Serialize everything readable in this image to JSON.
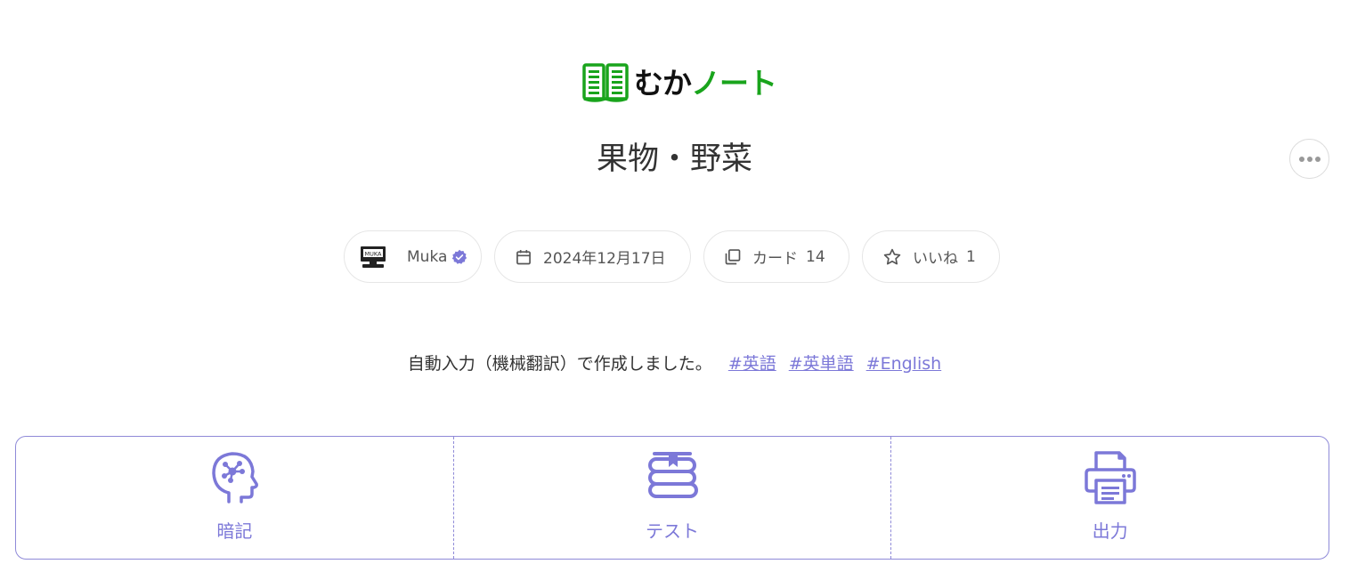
{
  "brand": {
    "name_part1": "むか",
    "name_part2": "ノート",
    "logo_icon": "open-book-icon",
    "color": "#19a41c"
  },
  "note": {
    "title": "果物・野菜",
    "author": "Muka",
    "author_avatar_text": "MUKA",
    "date": "2024年12月17日",
    "cards_label": "カード",
    "cards_count": "14",
    "likes_label": "いいね",
    "likes_count": "1",
    "description": "自動入力（機械翻訳）で作成しました。",
    "tags": [
      "#英語",
      "#英単語",
      "#English"
    ]
  },
  "actions": [
    {
      "label": "暗記",
      "icon": "brain-head-icon"
    },
    {
      "label": "テスト",
      "icon": "book-stack-icon"
    },
    {
      "label": "出力",
      "icon": "printer-icon"
    }
  ],
  "menu": {
    "icon": "more-horizontal-icon"
  },
  "colors": {
    "accent": "#7c78d8",
    "border": "#8f8ad8",
    "text": "#333333",
    "muted": "#555555"
  }
}
